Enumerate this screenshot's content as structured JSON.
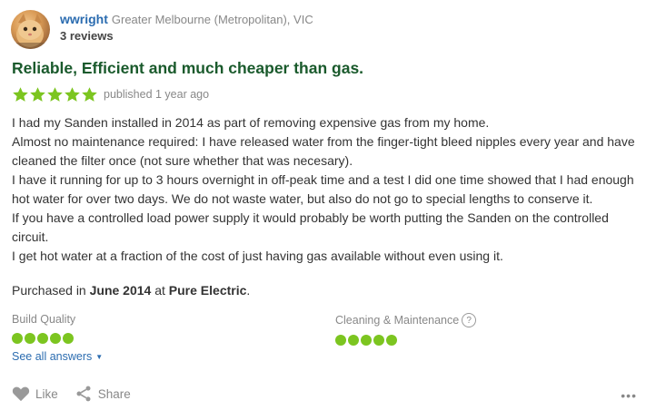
{
  "reviewer": {
    "name": "wwright",
    "location": "Greater Melbourne (Metropolitan), VIC",
    "review_count": "3 reviews",
    "avatar_icon": "cat-photo"
  },
  "review": {
    "title": "Reliable, Efficient and much cheaper than gas.",
    "rating": 5,
    "rating_max": 5,
    "published": "published 1 year ago",
    "paragraphs": [
      "I had my Sanden installed in 2014 as part of removing expensive gas from my home.",
      "Almost no maintenance required: I have released water from the finger-tight bleed nipples every year and have cleaned the filter once (not sure whether that was necesary).",
      "I have it running for up to 3 hours overnight in off-peak time and a test I did one time showed that I had enough hot water for over two days. We do not waste water, but also do not go to special lengths to conserve it.",
      "If you have a controlled load power supply it would probably be worth putting the Sanden on the controlled circuit.",
      "I get hot water at a fraction of the cost of just having gas available without even using it."
    ],
    "purchase": {
      "prefix": "Purchased in ",
      "date": "June 2014",
      "middle": " at ",
      "store": "Pure Electric",
      "suffix": "."
    }
  },
  "sub_ratings": [
    {
      "label": "Build Quality",
      "value": 5,
      "max": 5,
      "has_help": false
    },
    {
      "label": "Cleaning & Maintenance",
      "value": 5,
      "max": 5,
      "has_help": true,
      "help_glyph": "?"
    }
  ],
  "see_all_label": "See all answers",
  "actions": {
    "like_label": "Like",
    "share_label": "Share",
    "more_glyph": "•••"
  },
  "colors": {
    "star": "#7cc520",
    "dot": "#7cc520",
    "title": "#1a5a2c",
    "link": "#2b6cb0"
  }
}
